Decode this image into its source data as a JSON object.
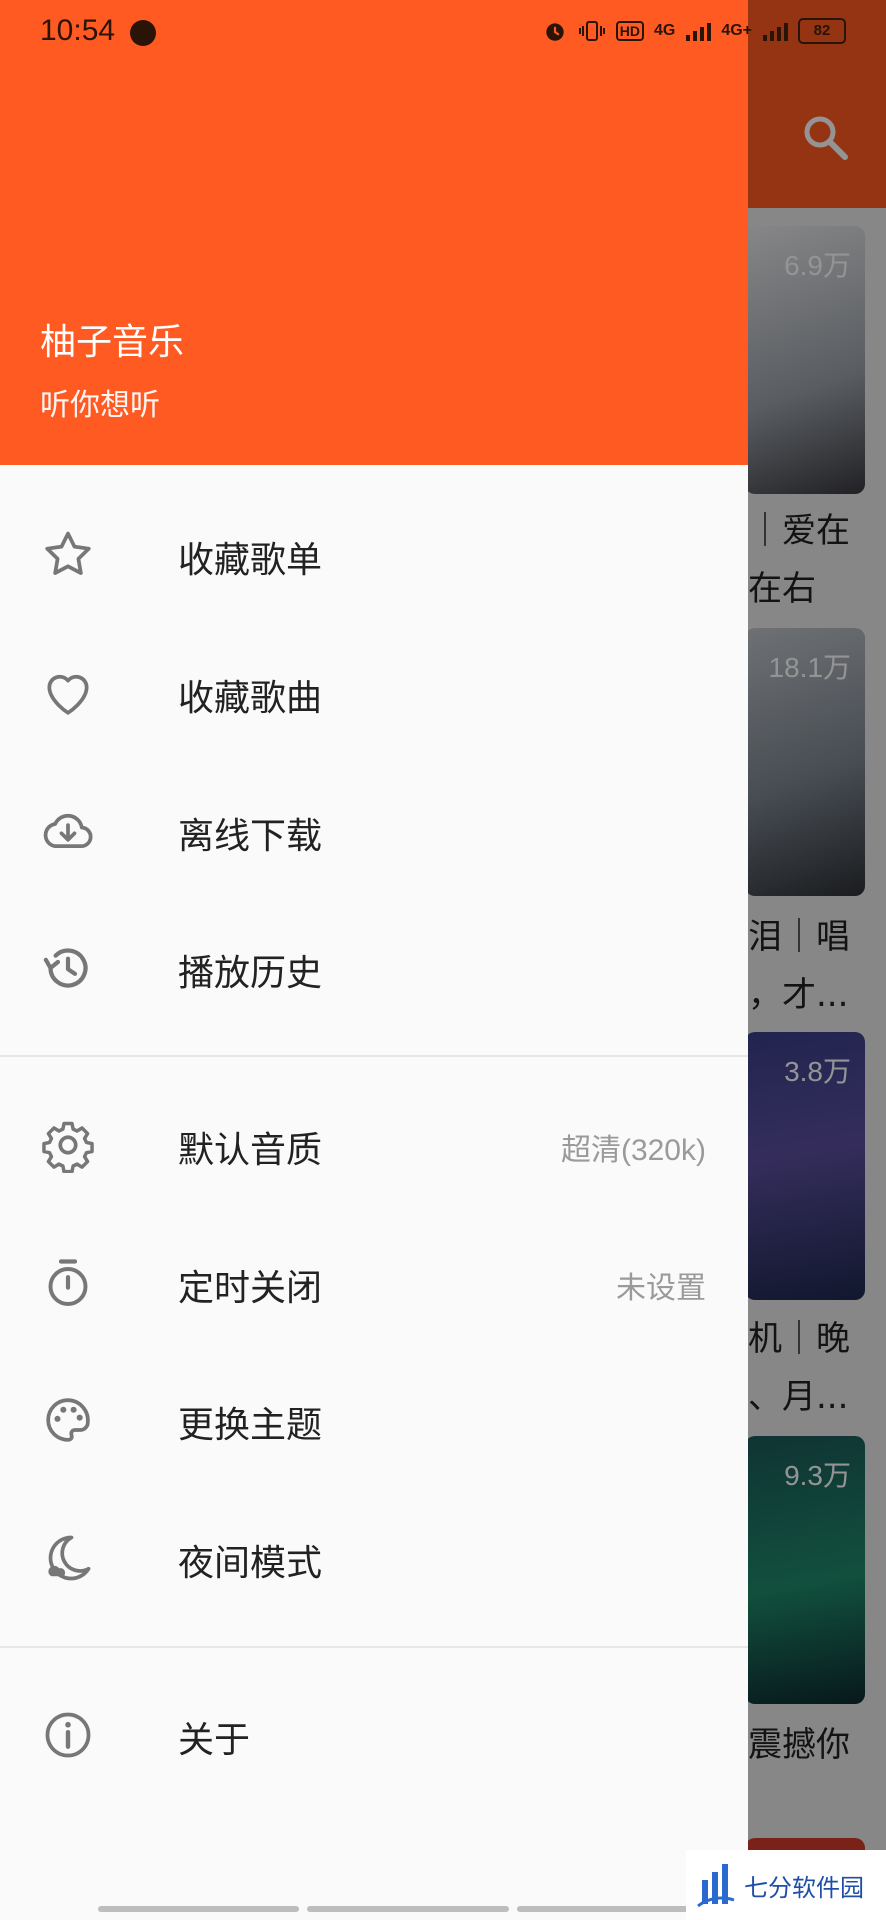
{
  "status_bar": {
    "time": "10:54",
    "battery": "82",
    "network_1": "4G",
    "network_2": "4G+",
    "hd_label": "HD"
  },
  "drawer": {
    "app_name": "柚子音乐",
    "slogan": "听你想听",
    "section_1": [
      {
        "label": "收藏歌单",
        "icon": "star-icon"
      },
      {
        "label": "收藏歌曲",
        "icon": "heart-icon"
      },
      {
        "label": "离线下载",
        "icon": "cloud-download-icon"
      },
      {
        "label": "播放历史",
        "icon": "history-icon"
      }
    ],
    "section_2": [
      {
        "label": "默认音质",
        "value": "超清(320k)",
        "icon": "gear-icon"
      },
      {
        "label": "定时关闭",
        "value": "未设置",
        "icon": "timer-icon"
      },
      {
        "label": "更换主题",
        "icon": "palette-icon"
      },
      {
        "label": "夜间模式",
        "icon": "moon-icon"
      }
    ],
    "section_3": [
      {
        "label": "关于",
        "icon": "info-icon"
      }
    ]
  },
  "background": {
    "cards": [
      {
        "count": "6.9万",
        "text_lines": [
          "｜爱在",
          "在右"
        ]
      },
      {
        "count": "18.1万",
        "text_lines": [
          "泪｜唱",
          "，才..."
        ]
      },
      {
        "count": "3.8万",
        "text_lines": [
          "机｜晚",
          "、月..."
        ]
      },
      {
        "count": "9.3万",
        "text_lines": [
          "震撼你"
        ]
      }
    ]
  },
  "watermark": {
    "text": "七分软件园"
  },
  "colors": {
    "accent": "#ff5a22",
    "drawer_bg": "#fafafa",
    "icon": "#777777",
    "secondary_text": "#9a9a9a"
  }
}
